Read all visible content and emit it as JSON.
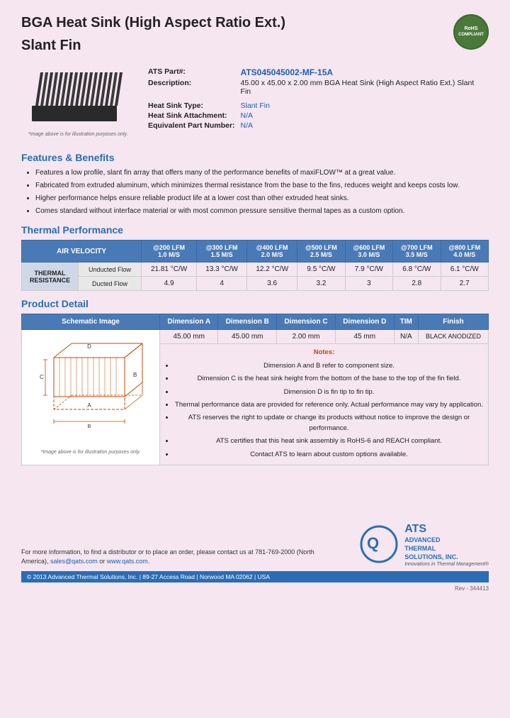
{
  "page": {
    "title_line1": "BGA Heat Sink (High Aspect Ratio Ext.)",
    "title_line2": "Slant Fin",
    "rohs_line1": "RoHS",
    "rohs_line2": "COMPLIANT",
    "image_note": "*Image above is for illustration purposes only.",
    "part_label": "ATS Part#:",
    "part_number": "ATS045045002-MF-15A",
    "desc_label": "Description:",
    "description": "45.00 x 45.00 x 2.00 mm  BGA Heat Sink (High Aspect Ratio Ext.) Slant Fin",
    "type_label": "Heat Sink Type:",
    "type_value": "Slant Fin",
    "attachment_label": "Heat Sink Attachment:",
    "attachment_value": "N/A",
    "equiv_label": "Equivalent Part Number:",
    "equiv_value": "N/A"
  },
  "features": {
    "section_title": "Features & Benefits",
    "items": [
      "Features a low profile, slant fin array that offers many of the performance benefits of maxiFLOW™ at a great value.",
      "Fabricated from extruded aluminum, which minimizes thermal resistance from the base to the fins, reduces weight and keeps costs low.",
      "Higher performance helps ensure reliable product life at a lower cost than other extruded heat sinks.",
      "Comes standard without interface material or with most common pressure sensitive thermal tapes as a custom option."
    ]
  },
  "thermal_performance": {
    "section_title": "Thermal Performance",
    "air_velocity_label": "AIR VELOCITY",
    "columns": [
      {
        "lfm": "@200 LFM",
        "ms": "1.0 M/S"
      },
      {
        "lfm": "@300 LFM",
        "ms": "1.5 M/S"
      },
      {
        "lfm": "@400 LFM",
        "ms": "2.0 M/S"
      },
      {
        "lfm": "@500 LFM",
        "ms": "2.5 M/S"
      },
      {
        "lfm": "@600 LFM",
        "ms": "3.0 M/S"
      },
      {
        "lfm": "@700 LFM",
        "ms": "3.5 M/S"
      },
      {
        "lfm": "@800 LFM",
        "ms": "4.0 M/S"
      }
    ],
    "thermal_resistance_label": "THERMAL RESISTANCE",
    "unducted_label": "Unducted Flow",
    "unducted_values": [
      "21.81 °C/W",
      "13.3 °C/W",
      "12.2 °C/W",
      "9.5 °C/W",
      "7.9 °C/W",
      "6.8 °C/W",
      "6.1 °C/W"
    ],
    "ducted_label": "Ducted Flow",
    "ducted_values": [
      "4.9",
      "4",
      "3.6",
      "3.2",
      "3",
      "2.8",
      "2.7"
    ]
  },
  "product_detail": {
    "section_title": "Product Detail",
    "schematic_label": "Schematic Image",
    "schematic_note": "*Image above is for illustration purposes only.",
    "columns": [
      "Dimension A",
      "Dimension B",
      "Dimension C",
      "Dimension D",
      "TIM",
      "Finish"
    ],
    "values": [
      "45.00 mm",
      "45.00 mm",
      "2.00 mm",
      "45 mm",
      "N/A",
      "BLACK ANODIZED"
    ],
    "notes_title": "Notes:",
    "notes": [
      "Dimension A and B refer to component size.",
      "Dimension C is the heat sink height from the bottom of the base to the top of the fin field.",
      "Dimension D is fin tip to fin tip.",
      "Thermal performance data are provided for reference only. Actual performance may vary by application.",
      "ATS reserves the right to update or change its products without notice to improve the design or performance.",
      "ATS certifies that this heat sink assembly is RoHS-6 and REACH compliant.",
      "Contact ATS to learn about custom options available."
    ]
  },
  "footer": {
    "contact_text": "For more information, to find a distributor or to place an order, please contact us at 781-769-2000 (North America),",
    "email": "sales@qats.com",
    "or_text": "or",
    "website": "www.qats.com",
    "copyright": "© 2013 Advanced Thermal Solutions, Inc.  |  89-27 Access Road  |  Norwood MA  02062  |  USA",
    "company_name_line1": "ADVANCED",
    "company_name_line2": "THERMAL",
    "company_name_line3": "SOLUTIONS, INC.",
    "tagline": "Innovations in Thermal Management®",
    "rev": "Rev - 344413"
  }
}
